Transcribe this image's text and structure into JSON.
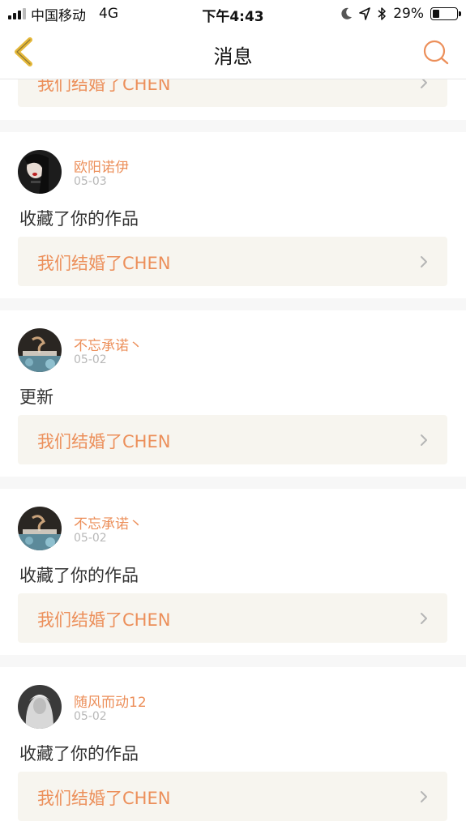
{
  "status_bar": {
    "carrier": "中国移动",
    "network": "4G",
    "time": "下午4:43",
    "battery_percent": "29%",
    "battery_level": 0.29
  },
  "nav": {
    "title": "消息"
  },
  "work_title": "我们结婚了CHEN",
  "messages": [
    {
      "username": "欧阳诺伊",
      "date": "05-03",
      "action": "收藏了你的作品",
      "work_title": "我们结婚了CHEN"
    },
    {
      "username": "不忘承诺丶",
      "date": "05-02",
      "action": "更新",
      "work_title": "我们结婚了CHEN"
    },
    {
      "username": "不忘承诺丶",
      "date": "05-02",
      "action": "收藏了你的作品",
      "work_title": "我们结婚了CHEN"
    },
    {
      "username": "随风而动12",
      "date": "05-02",
      "action": "收藏了你的作品",
      "work_title": "我们结婚了CHEN"
    }
  ],
  "colors": {
    "accent": "#ec8f5a",
    "link_bg": "#f7f5ef",
    "back_arrow": "#e5b83a"
  }
}
